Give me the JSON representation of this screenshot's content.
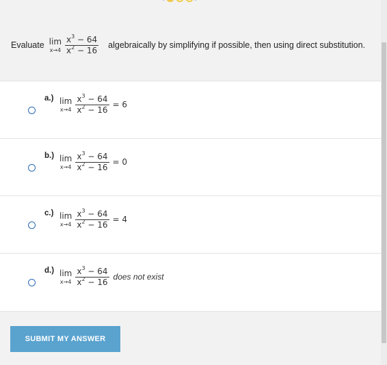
{
  "question": {
    "prefix": "Evaluate",
    "lim_word": "lim",
    "lim_sub": "x→4",
    "numerator": "x",
    "num_exp": "3",
    "num_rest": " − 64",
    "denominator": "x",
    "den_exp": "2",
    "den_rest": " − 16",
    "suffix": "algebraically by simplifying if possible, then using direct substitution."
  },
  "options": [
    {
      "letter": "a.)",
      "rhs": "= 6"
    },
    {
      "letter": "b.)",
      "rhs": "= 0"
    },
    {
      "letter": "c.)",
      "rhs": "= 4"
    },
    {
      "letter": "d.)",
      "rhs": "does not exist"
    }
  ],
  "submit_label": "SUBMIT MY ANSWER",
  "colors": {
    "accent": "#5aa3cf",
    "radio": "#2a69b8",
    "pager_dot": "#f0c94a"
  }
}
